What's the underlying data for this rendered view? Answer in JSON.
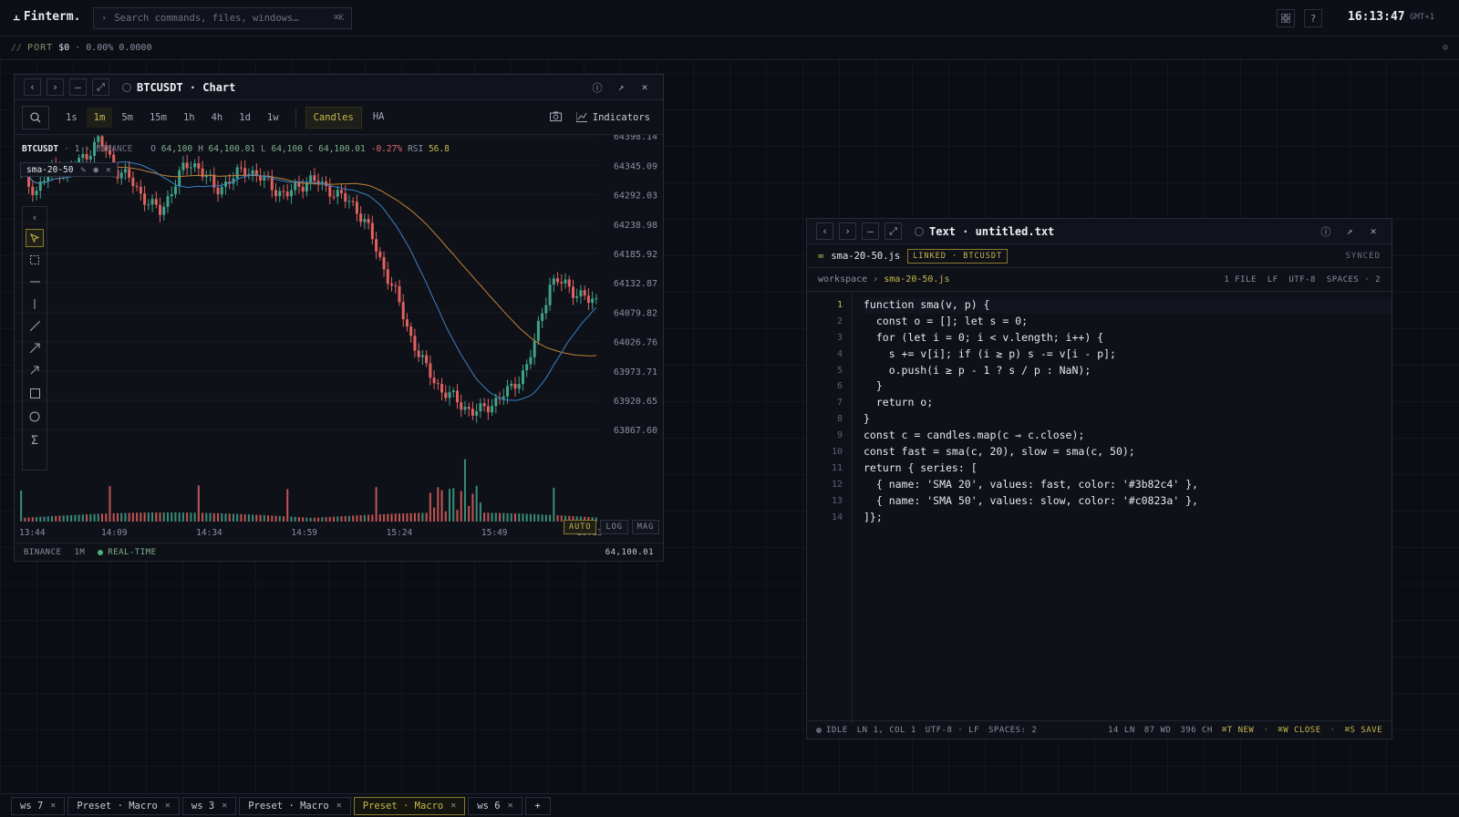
{
  "app": {
    "name": "Finterm.",
    "clock": "16:13:47",
    "timezone": "GMT+1"
  },
  "search": {
    "placeholder": "Search commands, files, windows…",
    "shortcut": "⌘K"
  },
  "port": {
    "label": "PORT",
    "value": "$0",
    "change": "· 0.00%",
    "amount": "0.0000"
  },
  "chart_window": {
    "title": "BTCUSDT · Chart",
    "timeframes": [
      "1s",
      "1m",
      "5m",
      "15m",
      "1h",
      "4h",
      "1d",
      "1w"
    ],
    "active_timeframe": "1m",
    "modes": [
      "Candles",
      "HA"
    ],
    "active_mode": "Candles",
    "indicators_label": "Indicators",
    "legend": {
      "symbol": "BTCUSDT",
      "interval": "1",
      "exchange": "BINANCE",
      "o": "64,100",
      "h": "64,100.01",
      "l": "64,100",
      "c": "64,100.01",
      "change": "-0.27%",
      "rsi": "56.8"
    },
    "overlay_tag": "sma-20-50",
    "scale_buttons": [
      "AUTO",
      "LOG",
      "MAG"
    ],
    "status": {
      "exchange": "BINANCE",
      "interval": "1M",
      "mode": "REAL-TIME",
      "price": "64,100.01"
    }
  },
  "chart_data": {
    "type": "candlestick",
    "y_ticks": [
      "64398.14",
      "64345.09",
      "64292.03",
      "64238.98",
      "64185.92",
      "64132.87",
      "64079.82",
      "64026.76",
      "63973.71",
      "63920.65",
      "63867.60"
    ],
    "x_ticks": [
      "13:44",
      "14:09",
      "14:34",
      "14:59",
      "15:24",
      "15:49",
      "16:13"
    ],
    "ylim": [
      63840,
      64400
    ],
    "series": [
      {
        "name": "SMA 20",
        "color": "#3b82c4"
      },
      {
        "name": "SMA 50",
        "color": "#c0823a"
      }
    ],
    "close_profile": [
      64330,
      64310,
      64300,
      64320,
      64335,
      64340,
      64330,
      64345,
      64360,
      64375,
      64390,
      64370,
      64340,
      64330,
      64320,
      64300,
      64285,
      64270,
      64260,
      64290,
      64320,
      64340,
      64350,
      64340,
      64320,
      64300,
      64310,
      64320,
      64330,
      64340,
      64330,
      64320,
      64310,
      64300,
      64290,
      64300,
      64310,
      64320,
      64315,
      64305,
      64300,
      64290,
      64280,
      64270,
      64250,
      64220,
      64180,
      64150,
      64120,
      64080,
      64040,
      64010,
      63980,
      63960,
      63940,
      63930,
      63920,
      63910,
      63900,
      63900,
      63910,
      63920,
      63930,
      63940,
      63960,
      63980,
      64020,
      64080,
      64130,
      64135,
      64130,
      64120,
      64110,
      64100,
      64100
    ]
  },
  "editor_window": {
    "title": "Text · untitled.txt",
    "file": "sma-20-50.js",
    "linked": "LINKED · BTCUSDT",
    "synced": "SYNCED",
    "breadcrumb": {
      "root": "workspace",
      "sep": "›",
      "file": "sma-20-50.js",
      "meta": "1 FILE  LF  UTF-8  SPACES · 2"
    },
    "status": {
      "state": "IDLE",
      "pos": "LN 1, COL 1",
      "enc": "UTF-8 · LF",
      "spaces": "SPACES: 2",
      "lines": "14 LN",
      "words": "87 WD",
      "chars": "396 CH",
      "new": "⌘T NEW",
      "close": "⌘W CLOSE",
      "save": "⌘S SAVE"
    }
  },
  "code_lines": [
    "function sma(v, p) {",
    "  const o = []; let s = 0;",
    "  for (let i = 0; i < v.length; i++) {",
    "    s += v[i]; if (i ≥ p) s -= v[i - p];",
    "    o.push(i ≥ p - 1 ? s / p : NaN);",
    "  }",
    "  return o;",
    "}",
    "const c = candles.map(c ⇒ c.close);",
    "const fast = sma(c, 20), slow = sma(c, 50);",
    "return { series: [",
    "  { name: 'SMA 20', values: fast, color: '#3b82c4' },",
    "  { name: 'SMA 50', values: slow, color: '#c0823a' },",
    "]};"
  ],
  "bottom_tabs": [
    {
      "label": "ws 7"
    },
    {
      "label": "Preset · Macro"
    },
    {
      "label": "ws 3"
    },
    {
      "label": "Preset · Macro"
    },
    {
      "label": "Preset · Macro",
      "active": true
    },
    {
      "label": "ws 6"
    }
  ]
}
